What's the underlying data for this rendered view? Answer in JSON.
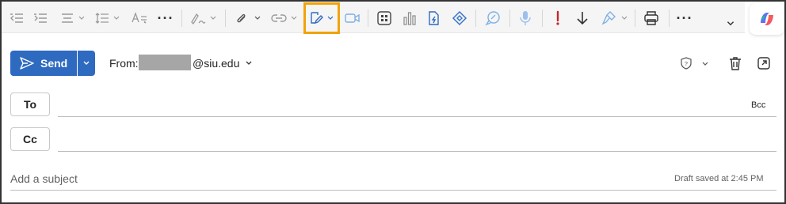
{
  "ribbon": {
    "tools": [
      {
        "icon": "decrease-indent-icon"
      },
      {
        "icon": "increase-indent-icon"
      },
      {
        "icon": "align-icon"
      },
      {
        "icon": "line-spacing-icon"
      },
      {
        "icon": "text-style-icon"
      },
      {
        "icon": "more-formatting-icon"
      },
      {
        "icon": "signature-pen-icon"
      },
      {
        "icon": "attach-file-icon"
      },
      {
        "icon": "link-icon"
      },
      {
        "icon": "editor-icon"
      },
      {
        "icon": "video-meeting-icon"
      },
      {
        "icon": "apps-icon"
      },
      {
        "icon": "poll-chart-icon"
      },
      {
        "icon": "quick-part-icon"
      },
      {
        "icon": "loop-icon"
      },
      {
        "icon": "chat-bubble-icon"
      },
      {
        "icon": "microphone-icon"
      },
      {
        "icon": "high-importance-icon"
      },
      {
        "icon": "low-importance-icon"
      },
      {
        "icon": "format-painter-icon"
      },
      {
        "icon": "print-icon"
      },
      {
        "icon": "more-options-icon"
      },
      {
        "icon": "expand-ribbon-icon"
      }
    ],
    "copilot_icon": "copilot-icon"
  },
  "compose": {
    "send_label": "Send",
    "from_label": "From:",
    "from_email_domain": "@siu.edu",
    "to_label": "To",
    "cc_label": "Cc",
    "bcc_label": "Bcc",
    "subject_placeholder": "Add a subject",
    "draft_status": "Draft saved at 2:45 PM"
  },
  "colors": {
    "accent": "#2e6ac0",
    "highlight_border": "#f0a30a",
    "ribbon_bg": "#f5f5f5"
  }
}
